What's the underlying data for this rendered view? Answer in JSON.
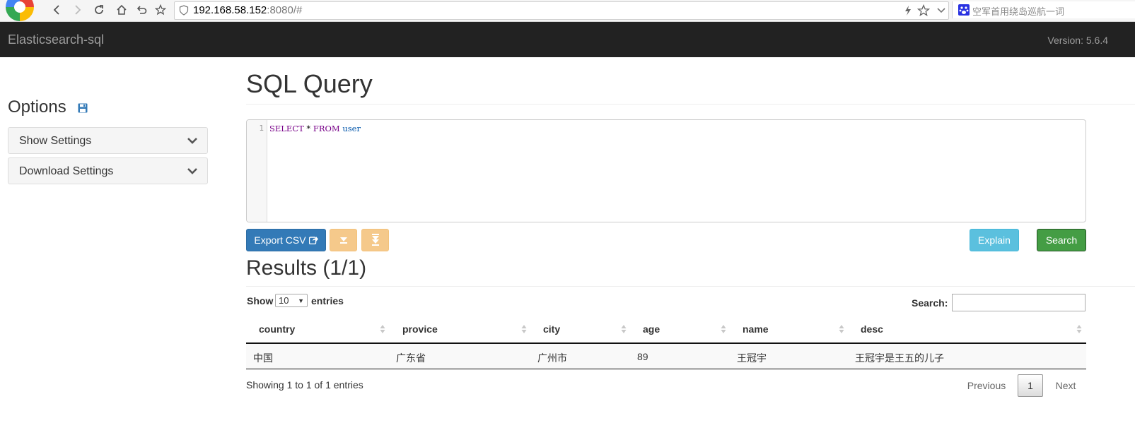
{
  "browser": {
    "url_host": "192.168.58.152",
    "url_rest": ":8080/#",
    "search_placeholder": "空军首用绕岛巡航一词"
  },
  "navbar": {
    "brand": "Elasticsearch-sql",
    "version": "Version: 5.6.4"
  },
  "sidebar": {
    "title": "Options",
    "panels": [
      {
        "label": "Show Settings"
      },
      {
        "label": "Download Settings"
      }
    ]
  },
  "main": {
    "title": "SQL Query",
    "editor": {
      "line_number": "1",
      "tokens": [
        "SELECT",
        " * ",
        "FROM",
        " user"
      ]
    },
    "buttons": {
      "export": "Export CSV",
      "explain": "Explain",
      "search": "Search"
    },
    "results_title": "Results (1/1)",
    "table": {
      "show_label": "Show",
      "page_size": "10",
      "entries_label": "entries",
      "search_label": "Search:",
      "search_value": "",
      "columns": [
        "country",
        "provice",
        "city",
        "age",
        "name",
        "desc"
      ],
      "rows": [
        [
          "中国",
          "广东省",
          "广州市",
          "89",
          "王冠宇",
          "王冠宇是王五的儿子"
        ]
      ],
      "info": "Showing 1 to 1 of 1 entries",
      "pagination": {
        "previous": "Previous",
        "current": "1",
        "next": "Next"
      }
    }
  },
  "colors": {
    "navbar_bg": "#222222",
    "primary": "#337ab7",
    "warning": "#f0ad4e",
    "info": "#5bc0de",
    "success": "#449d44"
  }
}
